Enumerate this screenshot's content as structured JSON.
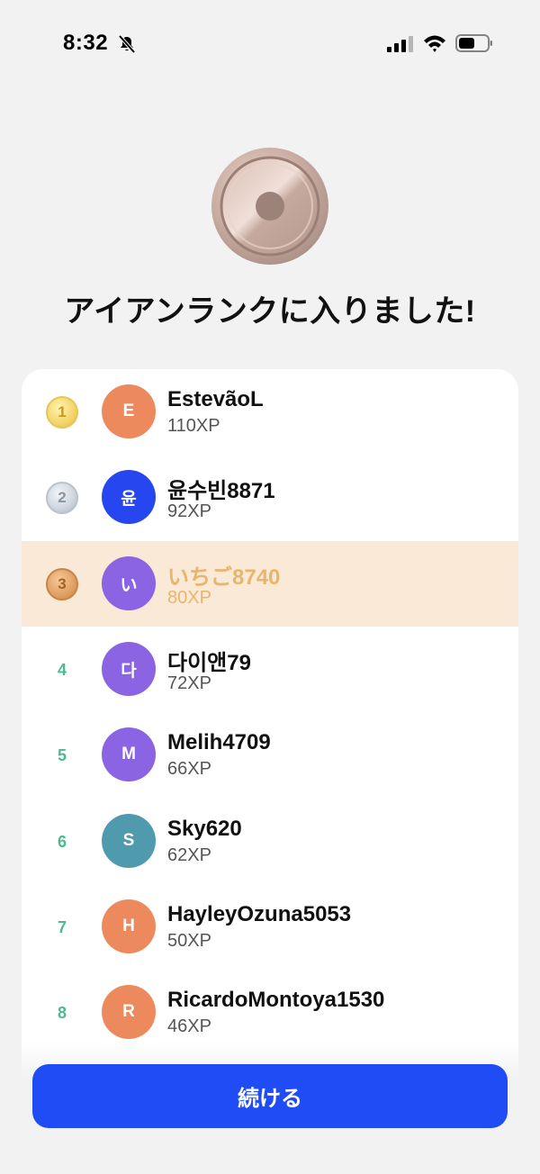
{
  "status_bar": {
    "time": "8:32"
  },
  "headline": "アイアンランクに入りました!",
  "leaderboard": [
    {
      "rank": "1",
      "initial": "E",
      "name": "EstevãoL",
      "xp": "110XP",
      "avatar_color": "#ec8a5e",
      "medal": "gold"
    },
    {
      "rank": "2",
      "initial": "윤",
      "name": "윤수빈8871",
      "xp": "92XP",
      "avatar_color": "#2647f0",
      "medal": "silver"
    },
    {
      "rank": "3",
      "initial": "い",
      "name": "いちご8740",
      "xp": "80XP",
      "avatar_color": "#8a64e2",
      "medal": "bronze",
      "current_user": true
    },
    {
      "rank": "4",
      "initial": "다",
      "name": "다이앤79",
      "xp": "72XP",
      "avatar_color": "#8a64e2"
    },
    {
      "rank": "5",
      "initial": "M",
      "name": "Melih4709",
      "xp": "66XP",
      "avatar_color": "#8a64e2"
    },
    {
      "rank": "6",
      "initial": "S",
      "name": "Sky620",
      "xp": "62XP",
      "avatar_color": "#4f9aad"
    },
    {
      "rank": "7",
      "initial": "H",
      "name": "HayleyOzuna5053",
      "xp": "50XP",
      "avatar_color": "#ec8a5e"
    },
    {
      "rank": "8",
      "initial": "R",
      "name": "RicardoMontoya1530",
      "xp": "46XP",
      "avatar_color": "#ec8a5e"
    }
  ],
  "continue_label": "続ける",
  "colors": {
    "accent": "#1f4cf4",
    "highlight_row": "#f9e9d6",
    "highlight_text": "#e9b56c",
    "rank_number": "#4cb98f"
  }
}
